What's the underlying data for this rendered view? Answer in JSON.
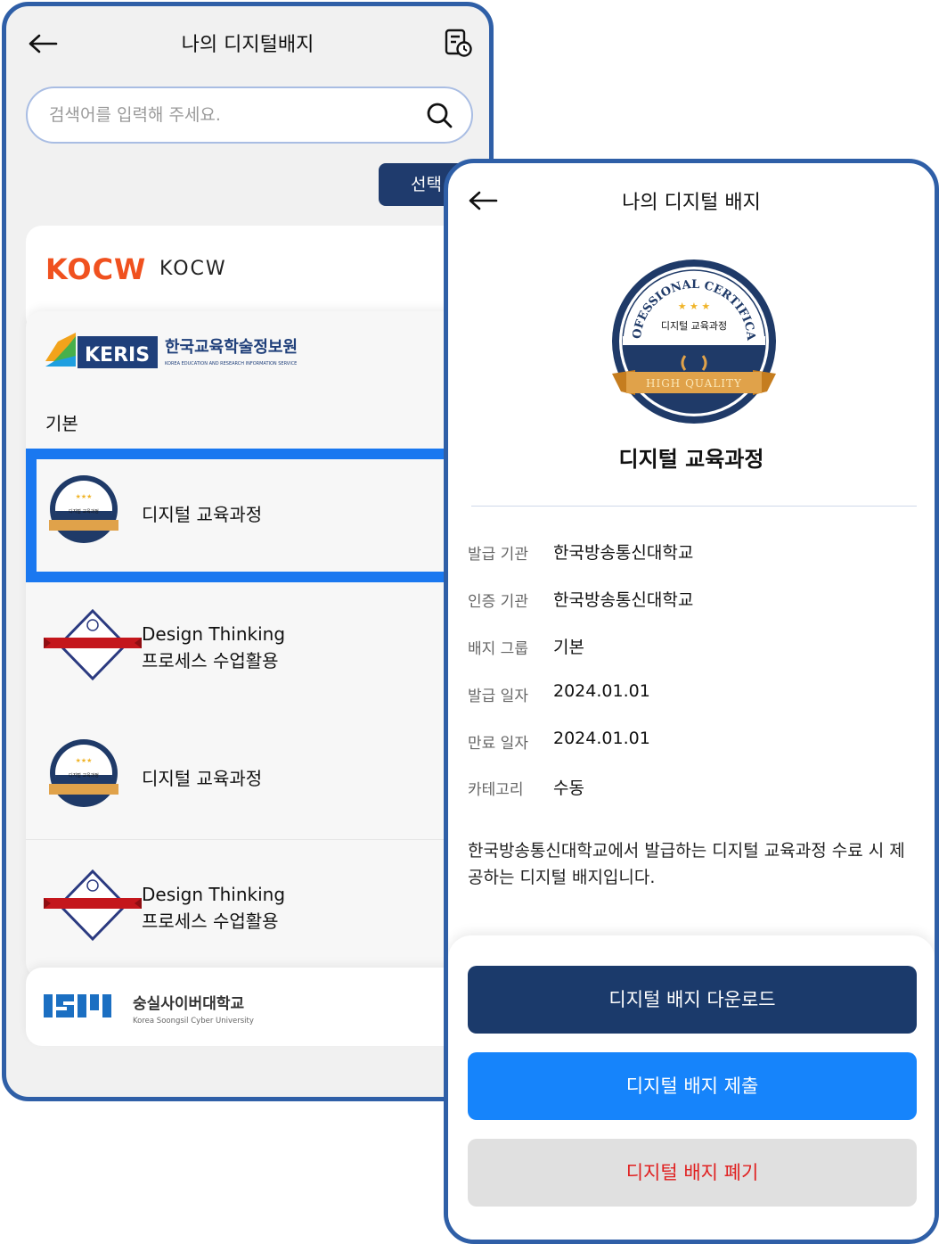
{
  "left_screen": {
    "header_title": "나의 디지털배지",
    "search_placeholder": "검색어를 입력해 주세요.",
    "select_button": "선택",
    "orgs": {
      "kocw": {
        "logo_text": "KOCW",
        "label": "KOCW"
      },
      "keris": {
        "logo_text": "KERIS",
        "logo_korean": "한국교육학술정보원",
        "logo_english": "KOREA EDUCATION AND RESEARCH INFORMATION SERVICE",
        "group_label": "기본",
        "badges": [
          {
            "title": "디지털 교육과정"
          },
          {
            "title_line1": "Design Thinking",
            "title_line2": "프로세스 수업활용"
          },
          {
            "title": "디지털 교육과정"
          },
          {
            "title_line1": "Design Thinking",
            "title_line2": "프로세스 수업활용"
          }
        ]
      },
      "ssu": {
        "name_korean": "숭실사이버대학교",
        "name_english": "Korea Soongsil Cyber University"
      }
    }
  },
  "right_screen": {
    "header_title": "나의 디지털 배지",
    "badge_arc_text": "PROFESSIONAL CERTIFICATE",
    "badge_inner_text": "디지털 교육과정",
    "badge_ribbon_text": "HIGH QUALITY",
    "badge_title": "디지털 교육과정",
    "info": {
      "issuer_label": "발급 기관",
      "issuer_value": "한국방송통신대학교",
      "certifier_label": "인증 기관",
      "certifier_value": "한국방송통신대학교",
      "group_label": "배지 그룹",
      "group_value": "기본",
      "issued_label": "발급 일자",
      "issued_value": "2024.01.01",
      "expires_label": "만료 일자",
      "expires_value": "2024.01.01",
      "category_label": "카테고리",
      "category_value": "수동"
    },
    "description": "한국방송통신대학교에서 발급하는 디지털 교육과정 수료 시 제공하는 디지털 배지입니다.",
    "buttons": {
      "download": "디지털 배지 다운로드",
      "submit": "디지털 배지 제출",
      "discard": "디지털 배지 폐기"
    }
  },
  "colors": {
    "frame": "#2f5fa7",
    "navy": "#1b3a6b",
    "primary_blue": "#1684fb",
    "highlight": "#1a78f0",
    "danger_text": "#e02020",
    "kocw_orange": "#f0511f",
    "keris_navy": "#1f3f7a"
  },
  "icons": [
    "back-arrow-icon",
    "history-icon",
    "search-icon",
    "chevron-down-icon",
    "chevron-up-icon"
  ]
}
